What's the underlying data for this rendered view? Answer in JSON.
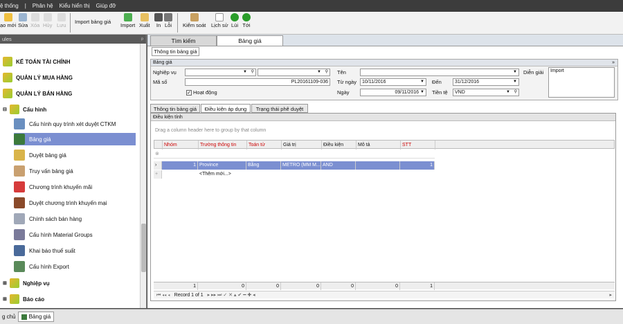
{
  "menu": [
    "ệ thống",
    "Phân hệ",
    "Kiểu hiển thị",
    "Giúp đỡ"
  ],
  "toolbar": {
    "new": "ạo mới",
    "edit": "Sửa",
    "delete": "Xóa",
    "cancel": "Hủy",
    "save": "Lưu",
    "import_price": "Import bảng giá",
    "import": "Import",
    "export": "Xuất",
    "print": "In",
    "error": "Lỗi",
    "control": "Kiểm soát",
    "history": "Lịch sử",
    "back": "Lùi",
    "forward": "Tới"
  },
  "left_pane": {
    "title": "ules",
    "pin": "ᵖ",
    "groups": [
      "KẾ TOÁN TÀI CHÍNH",
      "QUẢN LÝ MUA HÀNG",
      "QUẢN LÝ BÁN HÀNG"
    ],
    "config": "Cấu hình",
    "items": [
      "Cấu hình quy trình xét duyệt CTKM",
      "Bảng giá",
      "Duyệt bảng giá",
      "Truy vấn bảng giá",
      "Chương trình khuyến mãi",
      "Duyệt chương trình khuyến mại",
      "Chính sách bán hàng",
      "Cấu hình Material Groups",
      "Khai báo thuế suất",
      "Cấu hình Export"
    ],
    "nghiep_vu": "Nghiệp vụ",
    "bao_cao": "Báo cáo"
  },
  "tabs": {
    "search": "Tìm kiếm",
    "price": "Bảng giá"
  },
  "info_tab": "Thông tin bảng giá",
  "form": {
    "section": "Bảng giá",
    "collapse": "»",
    "nghiep_vu_label": "Nghiệp vụ",
    "ma_so_label": "Mã số",
    "ma_so": "PL20161109-036",
    "hoat_dong": "Hoạt động",
    "ten_label": "Tên",
    "tu_ngay_label": "Từ ngày",
    "tu_ngay": "10/11/2016",
    "den_label": "Đến",
    "den": "31/12/2016",
    "ngay_label": "Ngày",
    "ngay": "09/11/2016",
    "tien_te_label": "Tiền tệ",
    "tien_te": "VND",
    "dien_giai_label": "Diễn giải",
    "dien_giai": "Import"
  },
  "subtabs": [
    "Thông tin bảng giá",
    "Điều kiện áp dụng",
    "Trạng thái phê duyệt"
  ],
  "grid": {
    "title": "Điều kiện tính",
    "group_hint": "Drag a column header here to group by that column",
    "columns": [
      "Nhóm",
      "Trường thông tin",
      "Toán tử",
      "Giá trị",
      "Điều kiện",
      "Mô tả",
      "STT"
    ],
    "row": [
      "1",
      "Province",
      "Bằng",
      "METRO (MM M...",
      "AND",
      "",
      "1"
    ],
    "new_row": "<Thêm mới...>",
    "footer": [
      "1",
      "0",
      "0",
      "0",
      "0",
      "0",
      "1"
    ],
    "nav": "Record 1 of 1"
  },
  "taskbar": {
    "home": "g chủ",
    "tab": "Bảng giá"
  }
}
